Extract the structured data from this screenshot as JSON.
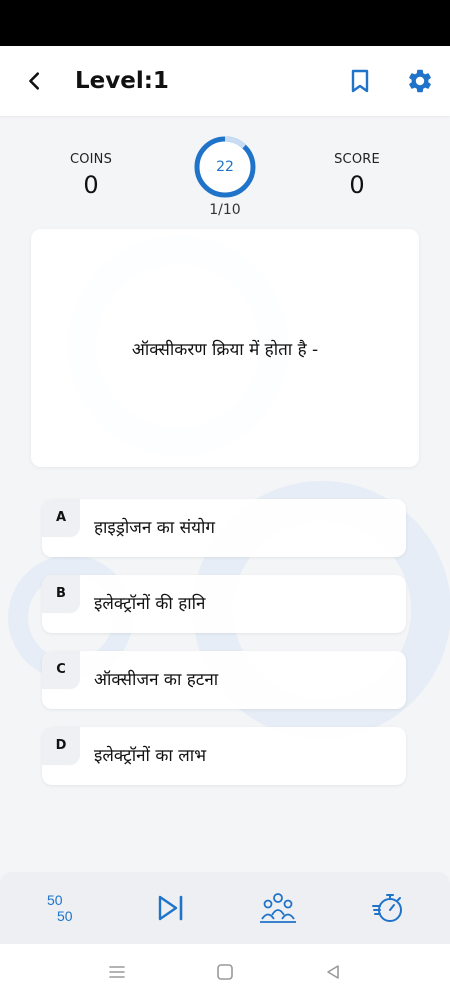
{
  "header": {
    "title": "Level:1"
  },
  "stats": {
    "coins_label": "COINS",
    "coins_value": "0",
    "score_label": "SCORE",
    "score_value": "0",
    "timer_value": "22",
    "timer_fraction": 0.12,
    "progress": "1/10"
  },
  "question": {
    "text": "ऑक्सीकरण क्रिया में होता है -"
  },
  "options": [
    {
      "letter": "A",
      "text": "हाइड्रोजन का संयोग"
    },
    {
      "letter": "B",
      "text": "इलेक्ट्रॉनों की हानि"
    },
    {
      "letter": "C",
      "text": "ऑक्सीजन का हटना"
    },
    {
      "letter": "D",
      "text": "इलेक्ट्रॉनों का लाभ"
    }
  ],
  "toolbar": {
    "fifty_top": "50",
    "fifty_bottom": "50"
  },
  "colors": {
    "accent": "#1f73c9",
    "ring_track": "#e3ebf5",
    "toolbar_bg": "#eeeff2"
  },
  "icons": {
    "back": "arrow-left-icon",
    "bookmark": "bookmark-icon",
    "settings": "gear-icon",
    "fifty": "fifty-fifty-icon",
    "skip": "skip-next-icon",
    "audience": "audience-poll-icon",
    "time": "stopwatch-icon"
  }
}
